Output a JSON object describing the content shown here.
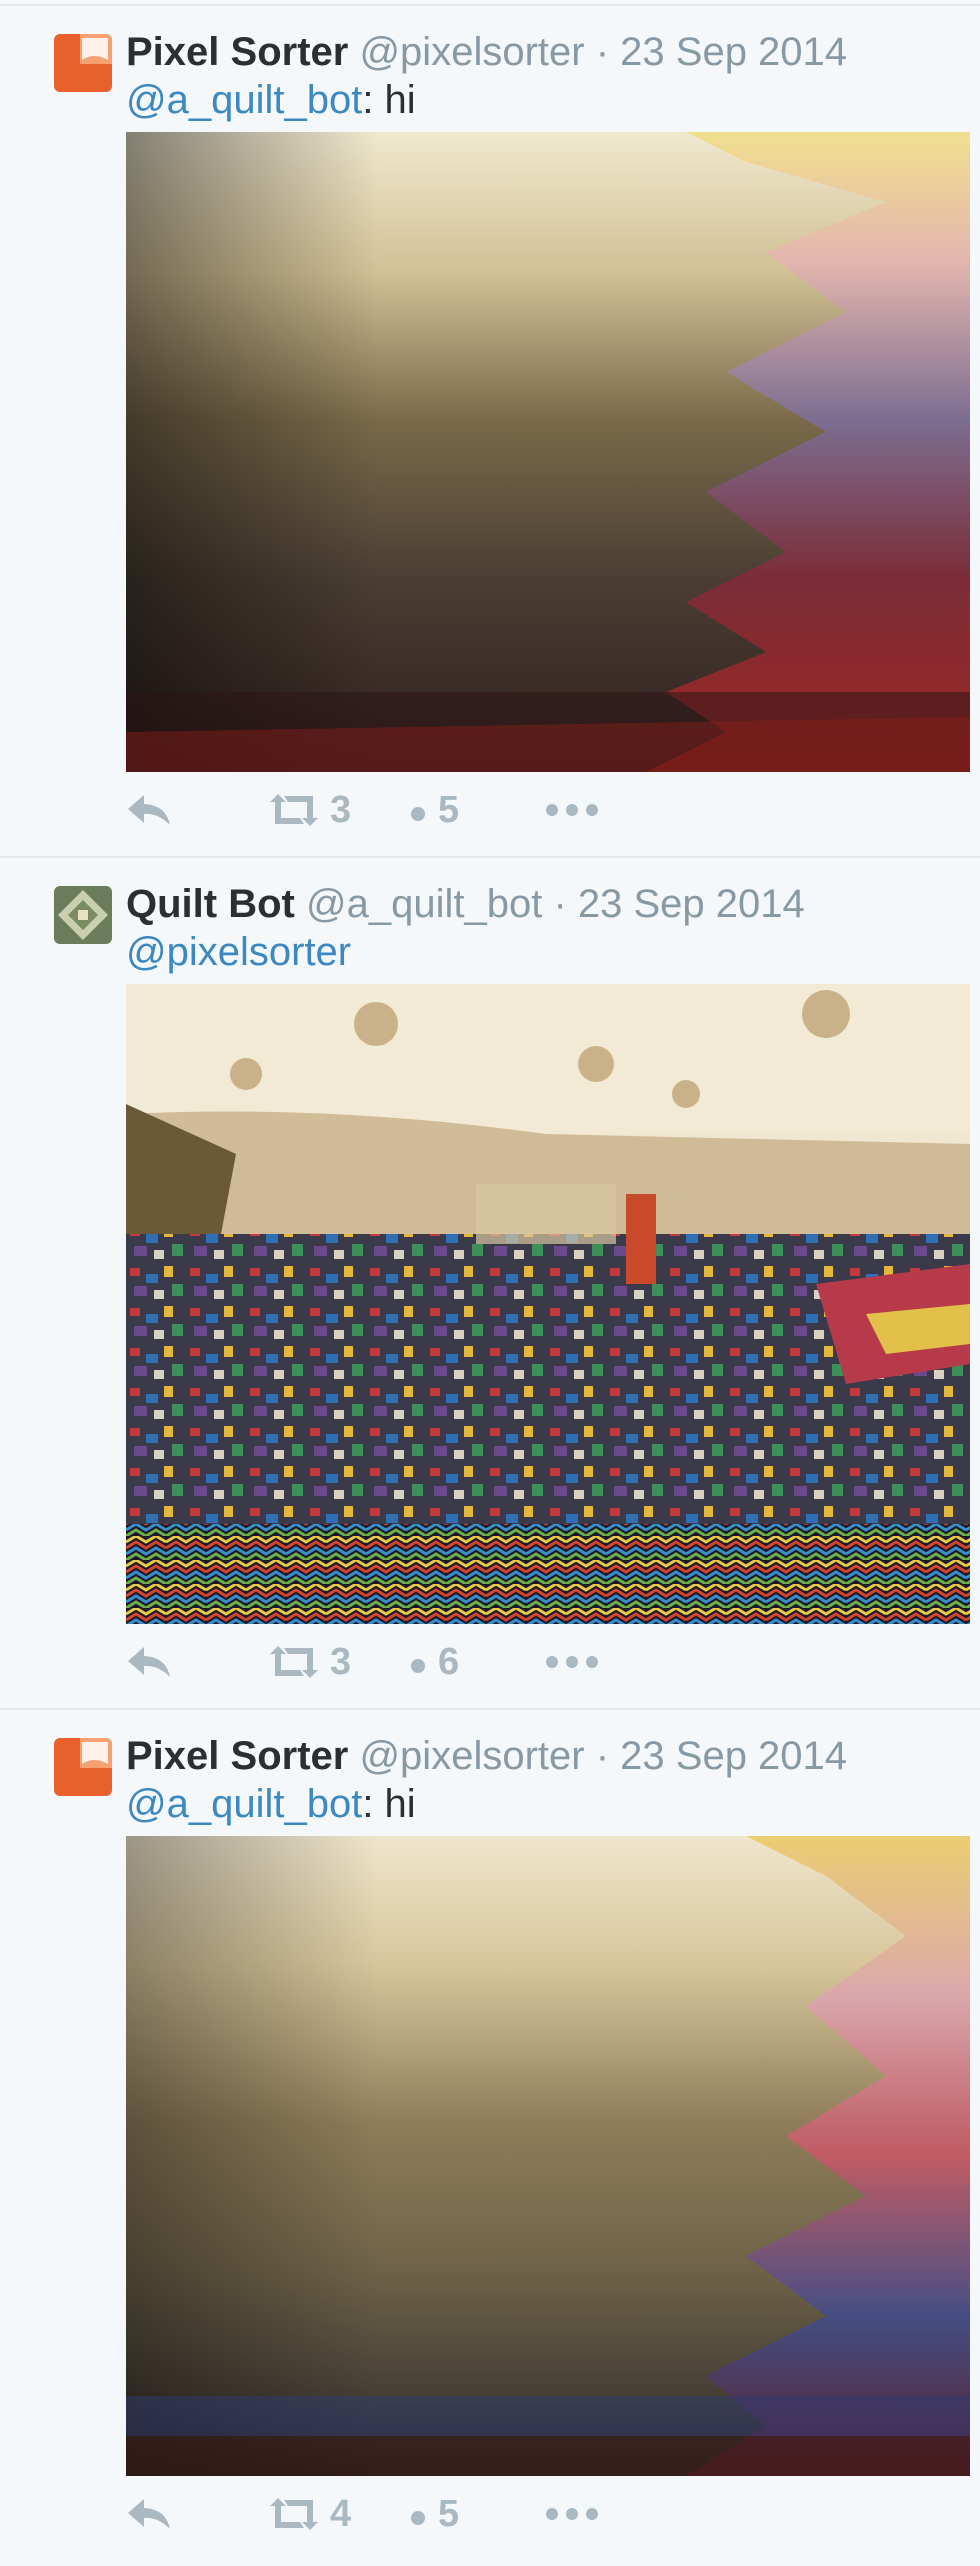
{
  "tweets": [
    {
      "display_name": "Pixel Sorter",
      "handle": "@pixelsorter",
      "separator": "·",
      "date": "23 Sep 2014",
      "reply_to": "@a_quilt_bot",
      "reply_text": ": hi",
      "retweets": "3",
      "likes": "5",
      "avatar_color": "#e8612c",
      "media": "pixel-sorted image"
    },
    {
      "display_name": "Quilt Bot",
      "handle": "@a_quilt_bot",
      "separator": "·",
      "date": "23 Sep 2014",
      "reply_to": "@pixelsorter",
      "reply_text": "",
      "retweets": "3",
      "likes": "6",
      "avatar_color": "#6b7c5a",
      "media": "quilt collage image"
    },
    {
      "display_name": "Pixel Sorter",
      "handle": "@pixelsorter",
      "separator": "·",
      "date": "23 Sep 2014",
      "reply_to": "@a_quilt_bot",
      "reply_text": ": hi",
      "retweets": "4",
      "likes": "5",
      "avatar_color": "#e8612c",
      "media": "pixel-sorted image"
    }
  ],
  "colors": {
    "background": "#f5f8fa",
    "text": "#292f33",
    "muted": "#8899a6",
    "link": "#3b88c3",
    "action_icon": "#aab8c2"
  }
}
